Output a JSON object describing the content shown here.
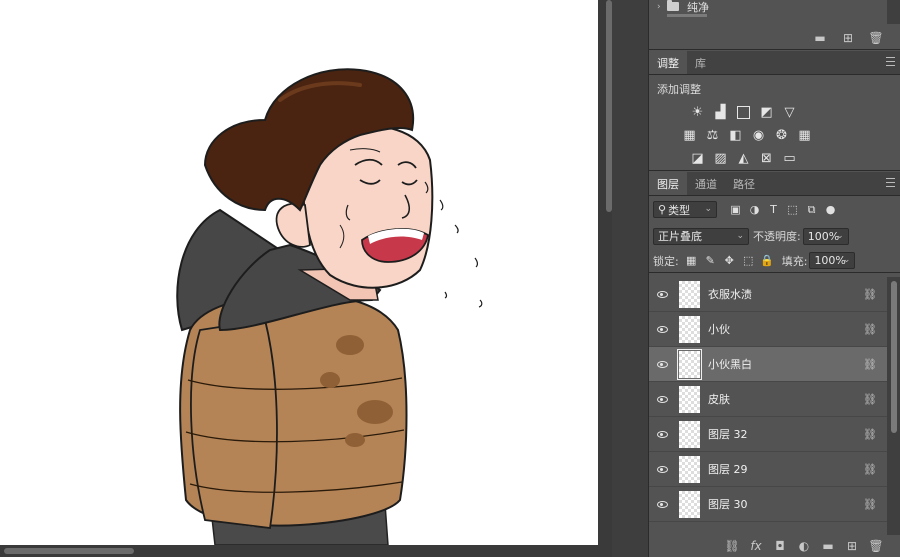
{
  "top_panel": {
    "folder_name": "纯净"
  },
  "adjustments": {
    "tabs": [
      "调整",
      "库"
    ],
    "add_label": "添加调整",
    "row1_icons": [
      "brightness-icon",
      "levels-icon",
      "curves-icon",
      "exposure-icon",
      "vibrance-icon"
    ],
    "row2_icons": [
      "hue-saturation-icon",
      "color-balance-icon",
      "black-white-icon",
      "photo-filter-icon",
      "channel-mixer-icon",
      "color-lookup-icon"
    ],
    "row3_icons": [
      "invert-icon",
      "posterize-icon",
      "threshold-icon",
      "selective-color-icon",
      "gradient-map-icon"
    ]
  },
  "layers_panel": {
    "tabs": [
      "图层",
      "通道",
      "路径"
    ],
    "filter_label": "类型",
    "blend_mode": "正片叠底",
    "opacity_label": "不透明度:",
    "opacity_value": "100%",
    "lock_label": "锁定:",
    "fill_label": "填充:",
    "fill_value": "100%",
    "layers": [
      {
        "name": "衣服水渍",
        "selected": false
      },
      {
        "name": "小伙",
        "selected": false
      },
      {
        "name": "小伙黑白",
        "selected": true
      },
      {
        "name": "皮肤",
        "selected": false
      },
      {
        "name": "图层 32",
        "selected": false
      },
      {
        "name": "图层 29",
        "selected": false
      },
      {
        "name": "图层 30",
        "selected": false
      }
    ]
  },
  "colors": {
    "panel_bg": "#535353",
    "selected_row": "#6a6a6a",
    "jacket": "#b48456",
    "hair": "#4a2410",
    "skin": "#f8d5c6",
    "hood": "#4a4a4a"
  }
}
